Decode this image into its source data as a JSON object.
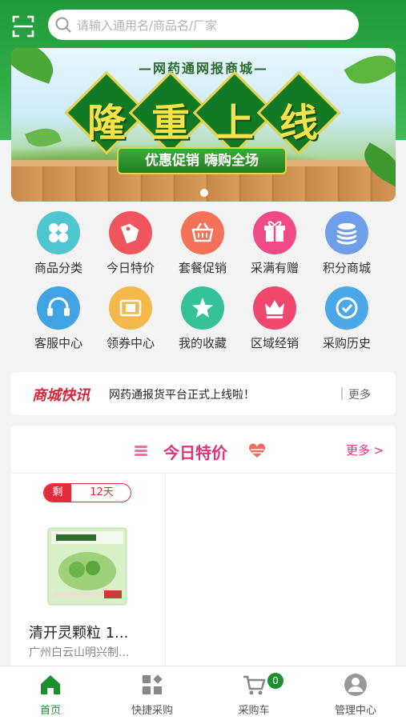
{
  "search": {
    "placeholder": "请输入通用名/商品名/厂家"
  },
  "banner": {
    "subtitle": "—网药通网报商城—",
    "title_chars": [
      "隆",
      "重",
      "上",
      "线"
    ],
    "slogan": "优惠促销 嗨购全场"
  },
  "menu": [
    {
      "label": "商品分类",
      "icon": "grid-icon",
      "color": "#4ec6cf"
    },
    {
      "label": "今日特价",
      "icon": "tag-icon",
      "color": "#f0545c"
    },
    {
      "label": "套餐促销",
      "icon": "basket-icon",
      "color": "#f4715a"
    },
    {
      "label": "采满有赠",
      "icon": "gift-icon",
      "color": "#f04a89"
    },
    {
      "label": "积分商城",
      "icon": "coins-icon",
      "color": "#6f9fe9"
    },
    {
      "label": "客服中心",
      "icon": "headset-icon",
      "color": "#3fa3e4"
    },
    {
      "label": "领券中心",
      "icon": "coupon-icon",
      "color": "#f5b84b"
    },
    {
      "label": "我的收藏",
      "icon": "star-icon",
      "color": "#35c29a"
    },
    {
      "label": "区域经销",
      "icon": "crown-icon",
      "color": "#f0476d"
    },
    {
      "label": "采购历史",
      "icon": "clock-icon",
      "color": "#4aa7e8"
    }
  ],
  "news": {
    "logo": "商城快讯",
    "text": "网药通报货平台正式上线啦！",
    "more": "更多"
  },
  "special": {
    "title": "今日特价",
    "more": "更多 >",
    "product": {
      "badge_left": "剩",
      "badge_right": "12天",
      "name": "清开灵颗粒 1...",
      "maker": "广州白云山明兴制..."
    }
  },
  "tabs": [
    {
      "label": "首页",
      "icon": "home-icon",
      "active": true
    },
    {
      "label": "快捷采购",
      "icon": "quick-buy-icon",
      "active": false
    },
    {
      "label": "采购车",
      "icon": "cart-icon",
      "active": false,
      "badge": "0"
    },
    {
      "label": "管理中心",
      "icon": "user-icon",
      "active": false
    }
  ],
  "colors": {
    "brand_green": "#1f9a3a",
    "accent_pink": "#e0337c",
    "badge_red": "#e32c3b"
  }
}
